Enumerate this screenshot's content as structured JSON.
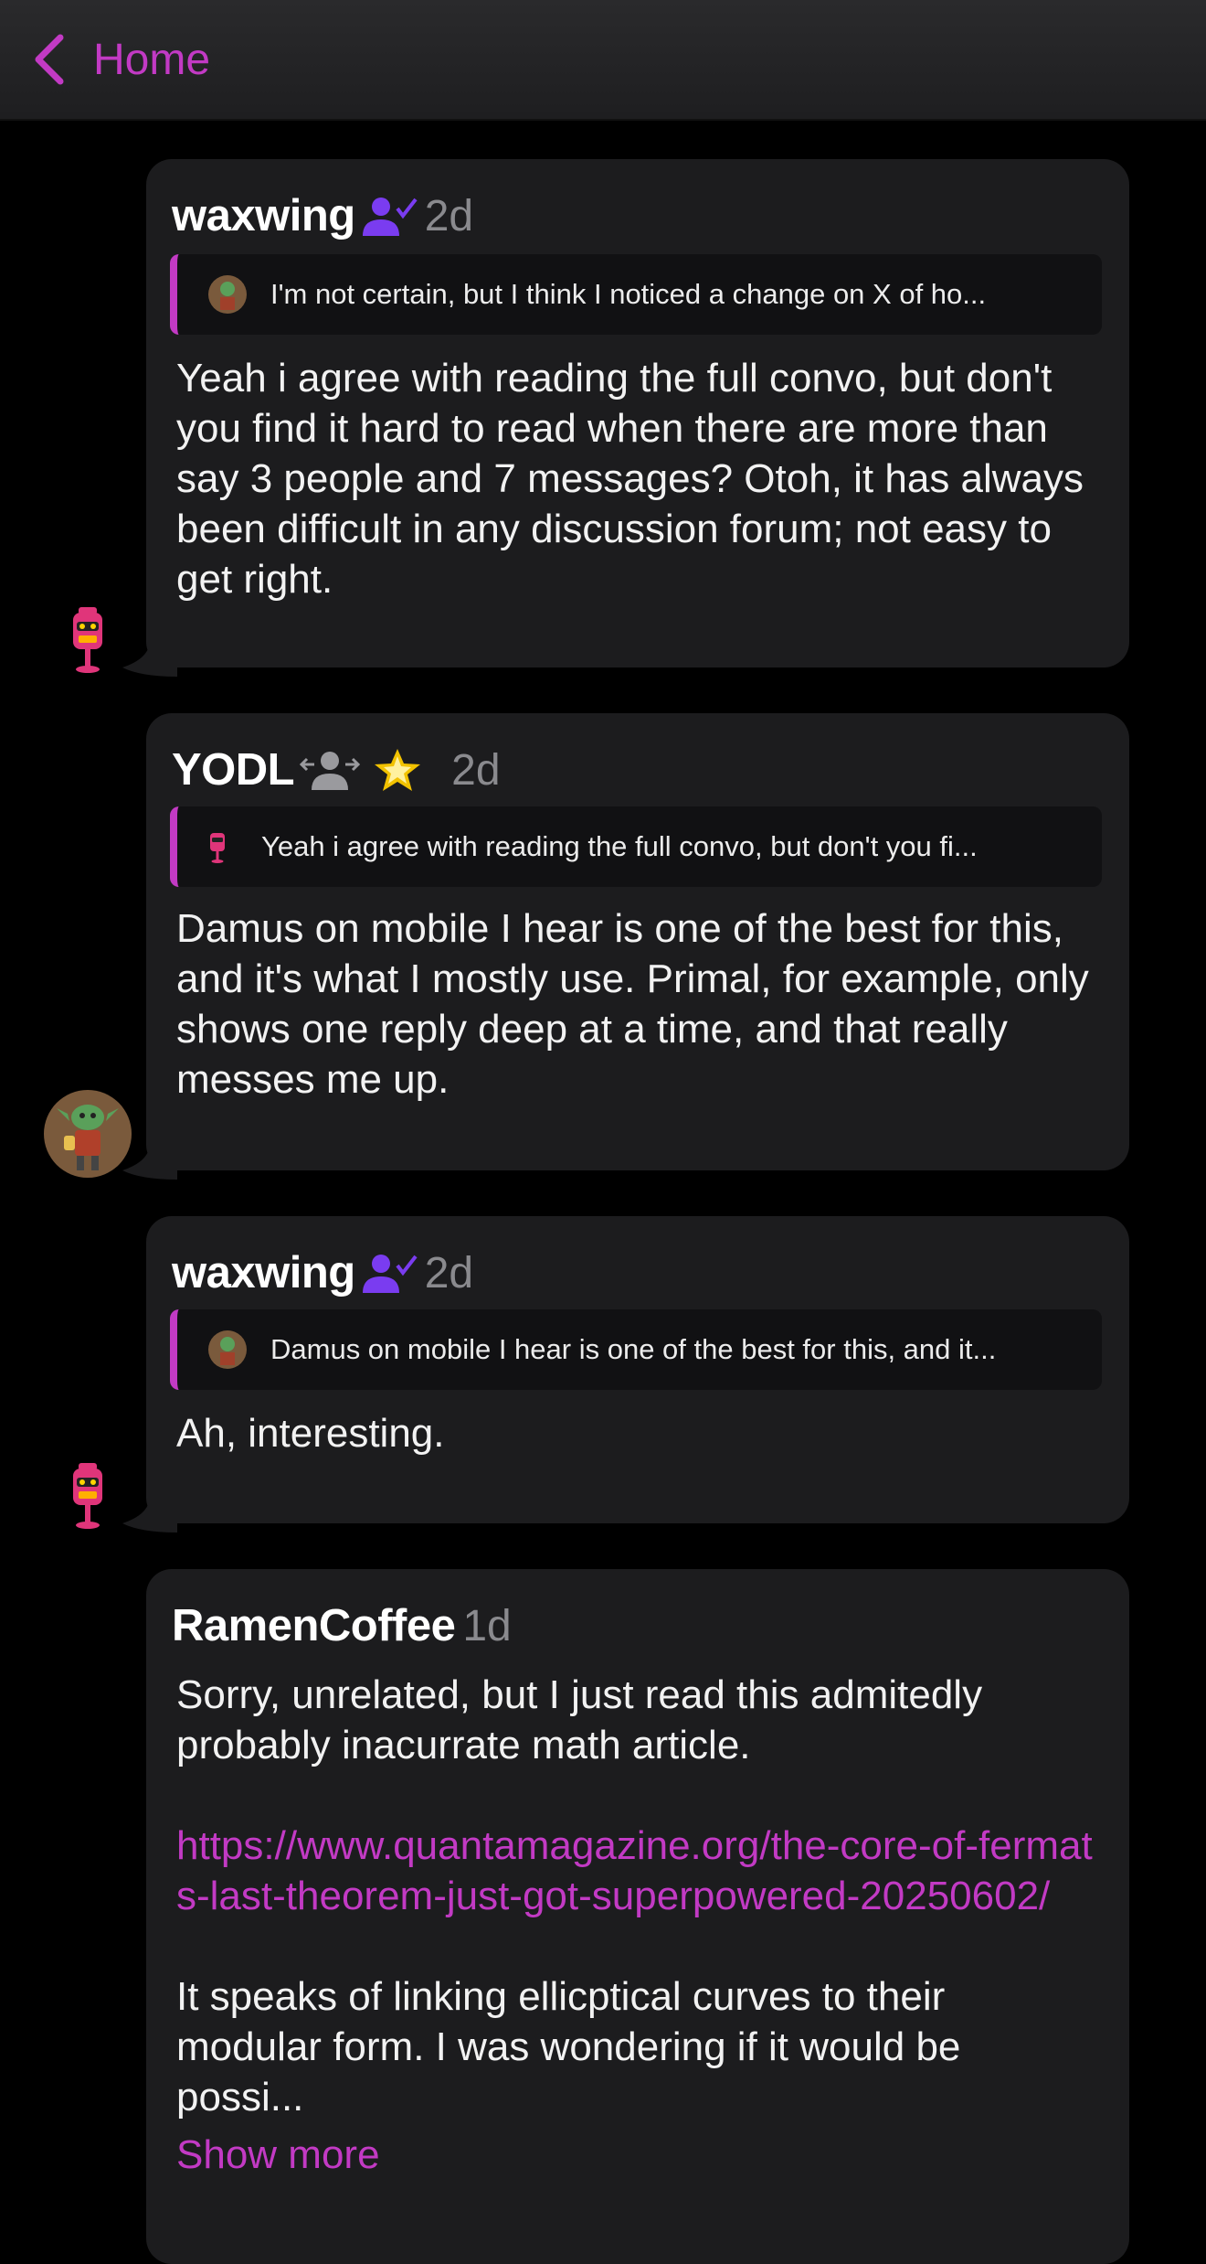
{
  "nav": {
    "back_label": "Home"
  },
  "colors": {
    "accent": "#c23ac4",
    "bubble": "#1c1c1e",
    "background": "#000000"
  },
  "messages": [
    {
      "author": "waxwing",
      "badge": "verified-user-icon",
      "time": "2d",
      "quote": "I'm not certain, but I think I noticed a change on X of ho...",
      "body": "Yeah i agree with reading the full convo, but don't you find it hard to read when there are more than say 3 people and 7 messages? Otoh, it has always been difficult in any discussion forum; not easy to get right."
    },
    {
      "author": "YODL",
      "badge": "follows-icon",
      "badge2": "star-icon",
      "time": "2d",
      "quote": "Yeah i agree with reading the full convo, but don't you fi...",
      "body": "Damus on mobile I hear is one of the best for this, and it's what I mostly use. Primal, for example, only shows one reply deep at a time, and that really messes me up."
    },
    {
      "author": "waxwing",
      "badge": "verified-user-icon",
      "time": "2d",
      "quote": "Damus on mobile I hear is one of the best for this, and it...",
      "body": "Ah, interesting."
    },
    {
      "author": "RamenCoffee",
      "time": "1d",
      "body_intro": "Sorry, unrelated, but I just read this admitedly probably inacurrate math article.",
      "link": "https://www.quantamagazine.org/the-core-of-fermats-last-theorem-just-got-superpowered-20250602/",
      "body_more": "It speaks of linking ellicptical curves to their modular form. I was wondering if it would be possi...",
      "show_more": "Show more"
    }
  ]
}
